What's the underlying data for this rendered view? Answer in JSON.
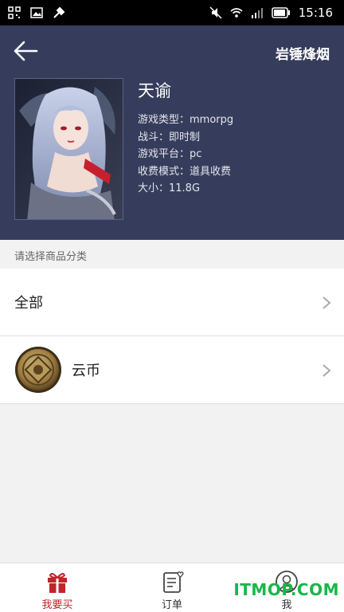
{
  "status_bar": {
    "time": "15:16"
  },
  "header": {
    "title": "岩锤烽烟"
  },
  "game": {
    "name": "天谕",
    "meta": [
      "游戏类型：mmorpg",
      "战斗：即时制",
      "游戏平台：pc",
      "收费模式：道具收费",
      "大小：11.8G"
    ]
  },
  "category_hint": "请选择商品分类",
  "categories": [
    {
      "label": "全部"
    },
    {
      "label": "云币"
    }
  ],
  "tabs": [
    {
      "label": "我要买",
      "icon": "gift-icon"
    },
    {
      "label": "订单",
      "icon": "order-list-icon"
    },
    {
      "label": "我",
      "icon": "user-icon"
    }
  ],
  "watermark": "ITMOP.COM",
  "colors": {
    "header_bg": "#363d5c",
    "accent": "#c0252a",
    "watermark": "#16b84a"
  }
}
